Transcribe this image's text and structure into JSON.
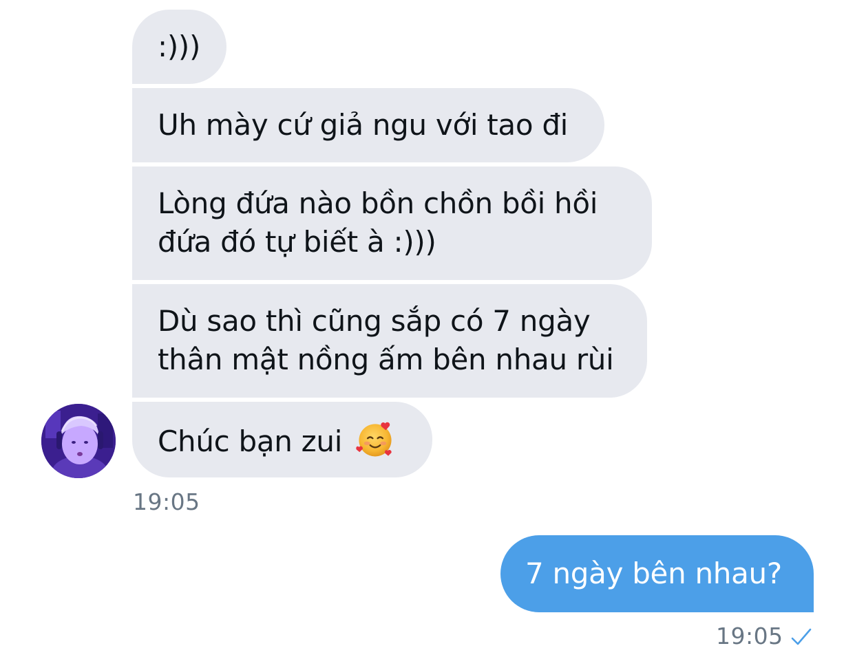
{
  "conversation": {
    "received": [
      {
        "lines": [
          ":)))"
        ]
      },
      {
        "lines": [
          "Uh mày cứ giả ngu với tao đi"
        ]
      },
      {
        "lines": [
          "Lòng đứa nào bồn chồn bồi hồi",
          "đứa đó tự biết à :)))"
        ]
      },
      {
        "lines": [
          "Dù sao thì cũng sắp có 7 ngày",
          "thân mật nồng ấm bên nhau rùi"
        ]
      },
      {
        "lines": [
          "Chúc bạn zui"
        ],
        "emoji": "smiling-face-with-hearts-icon"
      }
    ],
    "received_time": "19:05",
    "sent": [
      {
        "text": "7 ngày bên nhau?"
      }
    ],
    "sent_time": "19:05",
    "sent_status": "check-icon"
  },
  "colors": {
    "received_bubble": "#e7e9ef",
    "sent_bubble": "#4c9fe8",
    "timestamp": "#687684",
    "check": "#4c9fe8"
  }
}
